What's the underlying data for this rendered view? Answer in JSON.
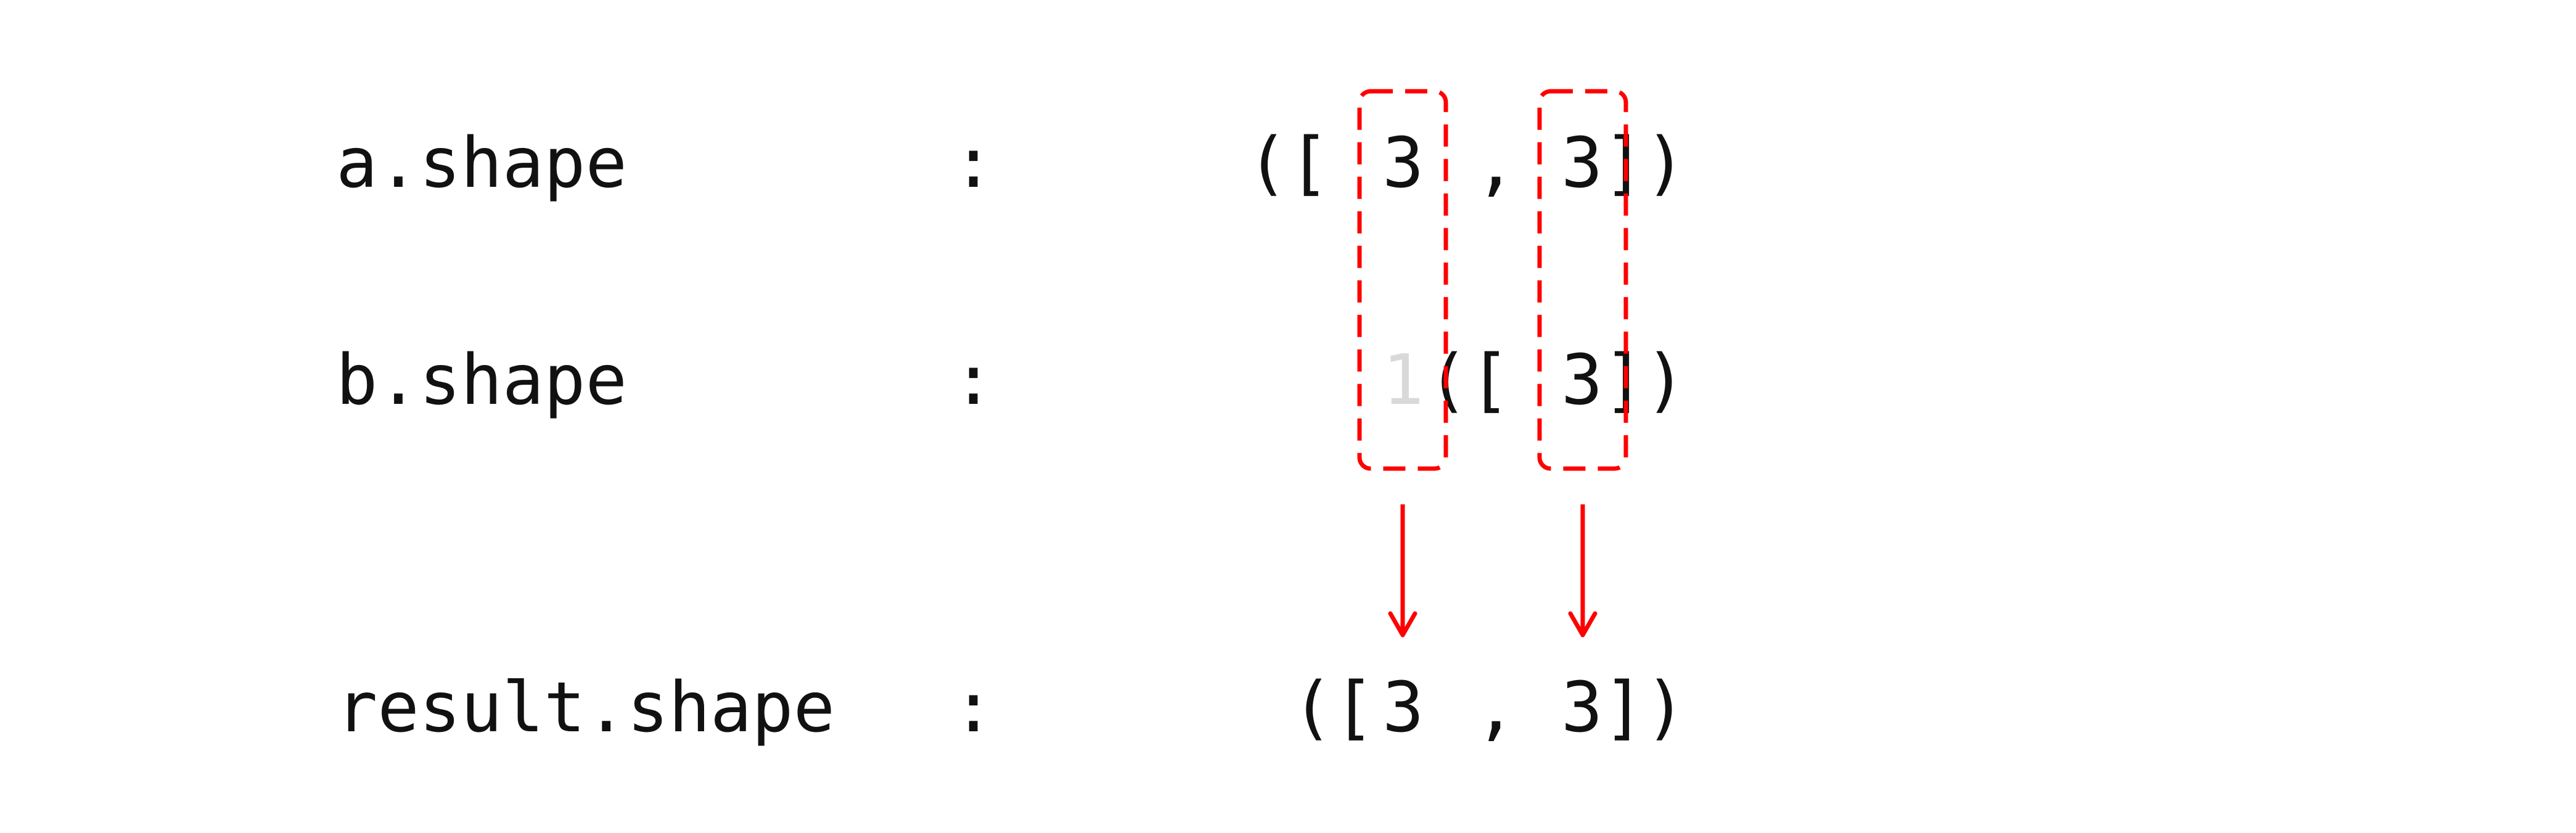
{
  "rows": {
    "a": {
      "label": "a.shape",
      "colon": ":",
      "open": "([",
      "dim1": "3",
      "comma": ",",
      "dim2": "3",
      "close": "])"
    },
    "b": {
      "label": "b.shape",
      "colon": ":",
      "implied_dim": "1",
      "open": "([",
      "dim2": "3",
      "close": "])"
    },
    "result": {
      "label": "result.shape",
      "colon": ":",
      "open": "([",
      "dim1": "3",
      "comma": ",",
      "dim2": "3",
      "close": "])"
    }
  },
  "colors": {
    "text": "#111111",
    "implied_text": "#d9d9d9",
    "highlight": "#ff0000"
  }
}
